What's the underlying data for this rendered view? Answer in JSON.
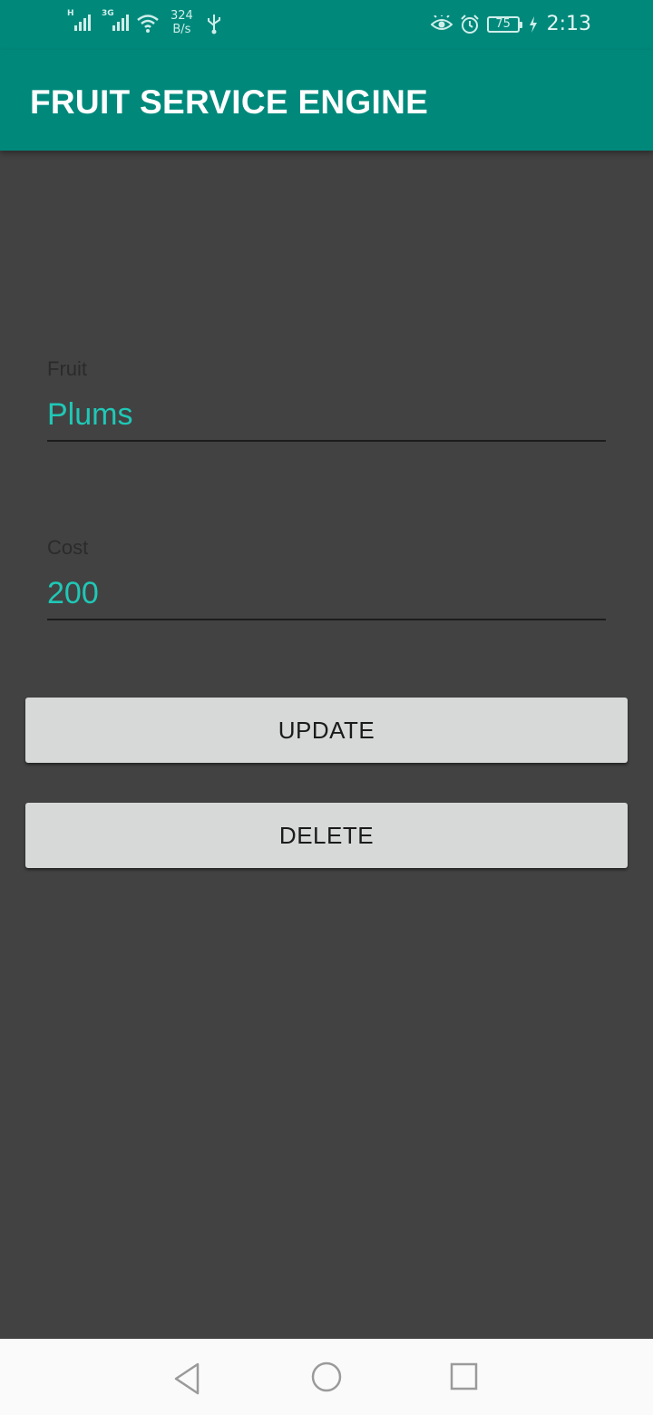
{
  "status_bar": {
    "signal1_label": "H",
    "signal2_label": "3G",
    "net_speed_value": "324",
    "net_speed_unit": "B/s",
    "battery": "75",
    "time": "2:13",
    "icons": [
      "signal-icon",
      "signal-icon",
      "wifi-icon",
      "usb-icon",
      "eye-icon",
      "alarm-icon",
      "battery-icon",
      "charging-icon"
    ]
  },
  "app_bar": {
    "title": "FRUIT SERVICE ENGINE"
  },
  "form": {
    "fruit_label": "Fruit",
    "fruit_value": "Plums",
    "cost_label": "Cost",
    "cost_value": "200"
  },
  "buttons": {
    "update": "UPDATE",
    "delete": "DELETE"
  },
  "navigation": {
    "icons": [
      "back-icon",
      "home-icon",
      "recents-icon"
    ]
  },
  "colors": {
    "primary": "#00897B",
    "accent": "#1FC8B6",
    "background": "#424242",
    "button": "#D7D8D8"
  }
}
